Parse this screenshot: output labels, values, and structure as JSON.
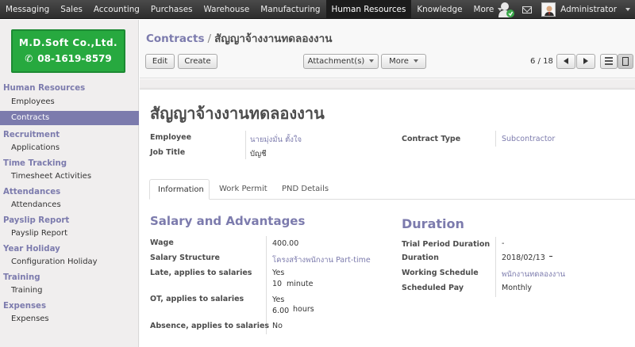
{
  "topbar": {
    "menu": [
      "Messaging",
      "Sales",
      "Accounting",
      "Purchases",
      "Warehouse",
      "Manufacturing",
      "Human Resources",
      "Knowledge",
      "More"
    ],
    "active_menu": "Human Resources",
    "user_name": "Administrator",
    "icons": [
      "chat-icon",
      "mail-icon",
      "user-avatar"
    ]
  },
  "logo": {
    "company": "M.D.Soft Co.,Ltd.",
    "phone": "08-1619-8579"
  },
  "sidebar": {
    "sections": [
      {
        "title": "Human Resources",
        "items": [
          "Employees",
          "Contracts"
        ]
      },
      {
        "title": "Recruitment",
        "items": [
          "Applications"
        ]
      },
      {
        "title": "Time Tracking",
        "items": [
          "Timesheet Activities"
        ]
      },
      {
        "title": "Attendances",
        "items": [
          "Attendances"
        ]
      },
      {
        "title": "Payslip Report",
        "items": [
          "Payslip Report"
        ]
      },
      {
        "title": "Year Holiday",
        "items": [
          "Configuration Holiday"
        ]
      },
      {
        "title": "Training",
        "items": [
          "Training"
        ]
      },
      {
        "title": "Expenses",
        "items": [
          "Expenses"
        ]
      }
    ],
    "active_item": "Contracts"
  },
  "header": {
    "breadcrumb_root": "Contracts",
    "breadcrumb_separator": "/",
    "breadcrumb_current": "สัญญาจ้างงานทดลองงาน",
    "edit_label": "Edit",
    "create_label": "Create",
    "attachment_label": "Attachment(s)",
    "more_label": "More",
    "pager": "6 / 18"
  },
  "form": {
    "title": "สัญญาจ้างงานทดลองงาน",
    "employee_label": "Employee",
    "employee_value": "นายมุ่งมั่น ตั้งใจ",
    "job_title_label": "Job Title",
    "job_title_value": "บัญชี",
    "contract_type_label": "Contract Type",
    "contract_type_value": "Subcontractor",
    "tabs": [
      "Information",
      "Work Permit",
      "PND Details"
    ],
    "active_tab": "Information",
    "salary": {
      "heading": "Salary and Advantages",
      "wage_label": "Wage",
      "wage_value": "400.00",
      "structure_label": "Salary Structure",
      "structure_value": "โครงสร้างพนักงาน Part-time",
      "late_label": "Late, applies to salaries",
      "late_value": "Yes",
      "late_amount": "10",
      "late_unit": "minute",
      "ot_label": "OT, applies to salaries",
      "ot_value": "Yes",
      "ot_amount": "6.00",
      "ot_unit": "hours",
      "absence_label": "Absence, applies to salaries",
      "absence_value": "No"
    },
    "duration": {
      "heading": "Duration",
      "trial_label": "Trial Period Duration",
      "trial_value": "-",
      "duration_label": "Duration",
      "duration_value": "2018/02/13",
      "schedule_label": "Working Schedule",
      "schedule_value": "พนักงานทดลองงาน",
      "pay_label": "Scheduled Pay",
      "pay_value": "Monthly"
    }
  },
  "colors": {
    "accent": "#7c7bad",
    "topbar": "#2d2d2d",
    "logo_green": "#27a93f"
  }
}
